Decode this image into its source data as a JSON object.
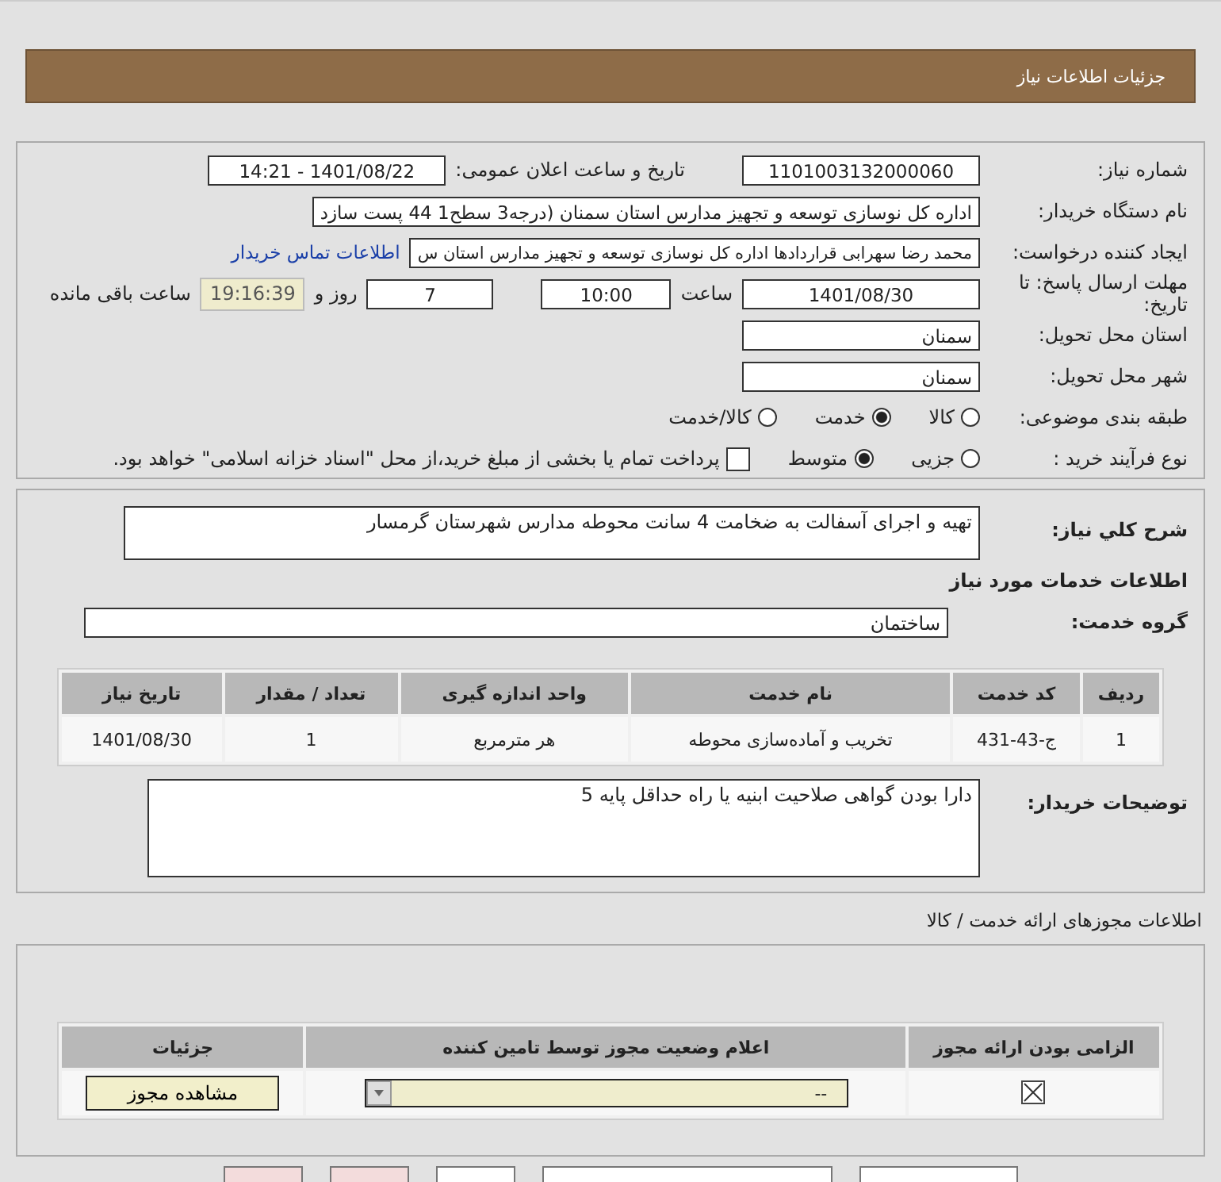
{
  "header": {
    "title": "جزئیات اطلاعات نیاز"
  },
  "info": {
    "need_number": {
      "label": "شماره نیاز:",
      "value": "1101003132000060"
    },
    "announce": {
      "label": "تاریخ و ساعت اعلان عمومی:",
      "value": "1401/08/22 - 14:21"
    },
    "buyer_org": {
      "label": "نام دستگاه خریدار:",
      "value": "اداره کل نوسازی   توسعه و تجهیز مدارس استان سمنان (درجه3  سطح1  44 پست سازد"
    },
    "requester": {
      "label": "ایجاد کننده درخواست:",
      "value": "محمد رضا سهرابی قراردادها اداره کل نوسازی   توسعه و تجهیز مدارس استان س",
      "link": "اطلاعات تماس خریدار"
    },
    "deadline": {
      "label": "مهلت ارسال پاسخ: تا تاریخ:",
      "date": "1401/08/30",
      "time_label": "ساعت",
      "time": "10:00",
      "days": "7",
      "days_label": "روز و",
      "remaining": "19:16:39",
      "remaining_label": "ساعت باقی مانده"
    },
    "province": {
      "label": "استان محل تحویل:",
      "value": "سمنان"
    },
    "city": {
      "label": "شهر محل تحویل:",
      "value": "سمنان"
    },
    "category": {
      "label": "طبقه بندی موضوعی:",
      "options": [
        {
          "label": "کالا",
          "selected": false
        },
        {
          "label": "خدمت",
          "selected": true
        },
        {
          "label": "کالا/خدمت",
          "selected": false
        }
      ]
    },
    "process": {
      "label": "نوع فرآیند خرید :",
      "options": [
        {
          "label": "جزیی",
          "selected": false
        },
        {
          "label": "متوسط",
          "selected": true
        }
      ],
      "treasury": {
        "label": "پرداخت تمام یا بخشی از مبلغ خرید،از محل \"اسناد خزانه اسلامی\" خواهد بود.",
        "checked": false
      }
    }
  },
  "description": {
    "label": "شرح کلي نياز:",
    "value": "تهیه و اجرای آسفالت به ضخامت 4 سانت  محوطه مدارس شهرستان گرمسار"
  },
  "services": {
    "heading": "اطلاعات خدمات مورد نیاز",
    "group": {
      "label": "گروه خدمت:",
      "value": "ساختمان"
    },
    "columns": [
      "ردیف",
      "کد خدمت",
      "نام خدمت",
      "واحد اندازه گیری",
      "تعداد / مقدار",
      "تاریخ نیاز"
    ],
    "rows": [
      [
        "1",
        "ج-43-431",
        "تخریب و آماده‌سازی محوطه",
        "هر مترمربع",
        "1",
        "1401/08/30"
      ]
    ]
  },
  "buyer_notes": {
    "label": "توضیحات خریدار:",
    "value": "دارا بودن گواهی صلاحیت ابنیه یا راه حداقل پایه 5"
  },
  "permits": {
    "title": "اطلاعات مجوزهای ارائه خدمت / کالا",
    "columns": [
      "الزامی بودن ارائه مجوز",
      "اعلام وضعیت مجوز توسط تامین کننده",
      "جزئیات"
    ],
    "rows": [
      {
        "required": true,
        "status": "--",
        "button": "مشاهده مجوز"
      }
    ]
  },
  "footer_buttons": [
    {
      "color": "#ffffff"
    },
    {
      "color": "#ffffff"
    },
    {
      "color": "#ffffff"
    },
    {
      "color": "#f3dcdc"
    },
    {
      "color": "#f3dcdc"
    }
  ]
}
